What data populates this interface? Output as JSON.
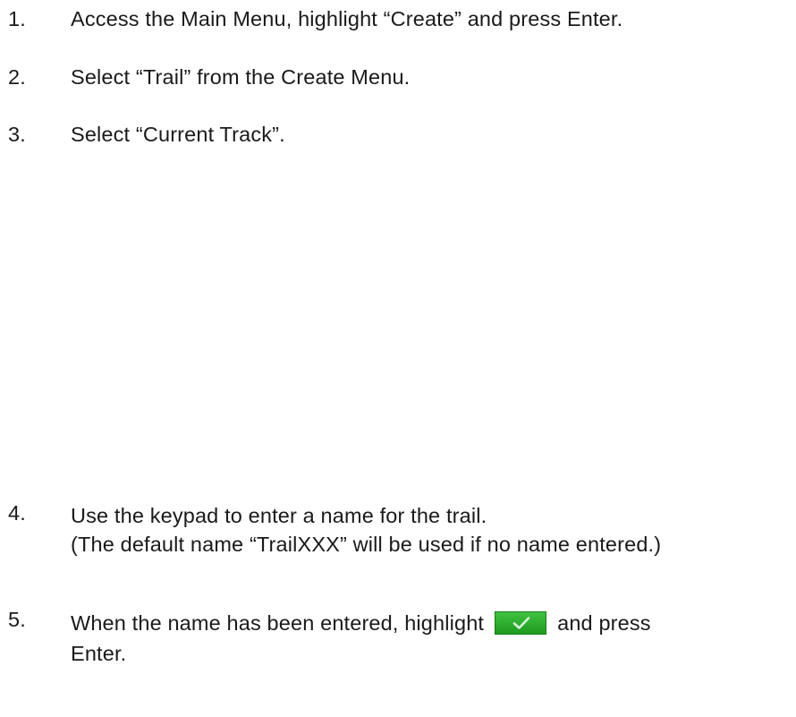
{
  "steps": [
    {
      "number": "1.",
      "text": "Access the Main Menu, highlight “Create” and press Enter."
    },
    {
      "number": "2.",
      "text": "Select “Trail” from the Create Menu."
    },
    {
      "number": "3.",
      "text": "Select “Current Track”."
    },
    {
      "number": "4.",
      "line1": "Use the keypad to enter a name for the trail.",
      "line2": "(The default name “TrailXXX” will be used if no name entered.)"
    },
    {
      "number": "5.",
      "before": "When the name has been entered, highlight",
      "after": "and press",
      "cont": "Enter.",
      "button_icon": "checkmark-icon",
      "button_color": "#2aa82a"
    }
  ]
}
